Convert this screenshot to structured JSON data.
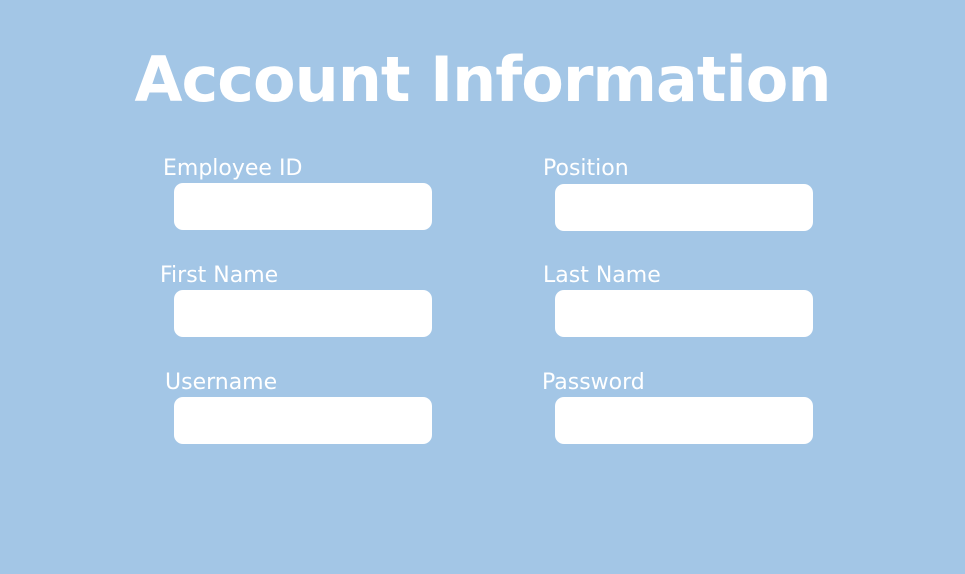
{
  "title": "Account Information",
  "fields": {
    "employee_id": {
      "label": "Employee ID",
      "value": "",
      "placeholder": ""
    },
    "position": {
      "label": "Position",
      "value": "",
      "placeholder": ""
    },
    "first_name": {
      "label": "First Name",
      "value": "",
      "placeholder": ""
    },
    "last_name": {
      "label": "Last Name",
      "value": "",
      "placeholder": ""
    },
    "username": {
      "label": "Username",
      "value": "",
      "placeholder": ""
    },
    "password": {
      "label": "Password",
      "value": "",
      "placeholder": ""
    }
  },
  "colors": {
    "background": "#a3c6e6",
    "text": "#ffffff",
    "input_background": "#ffffff"
  }
}
